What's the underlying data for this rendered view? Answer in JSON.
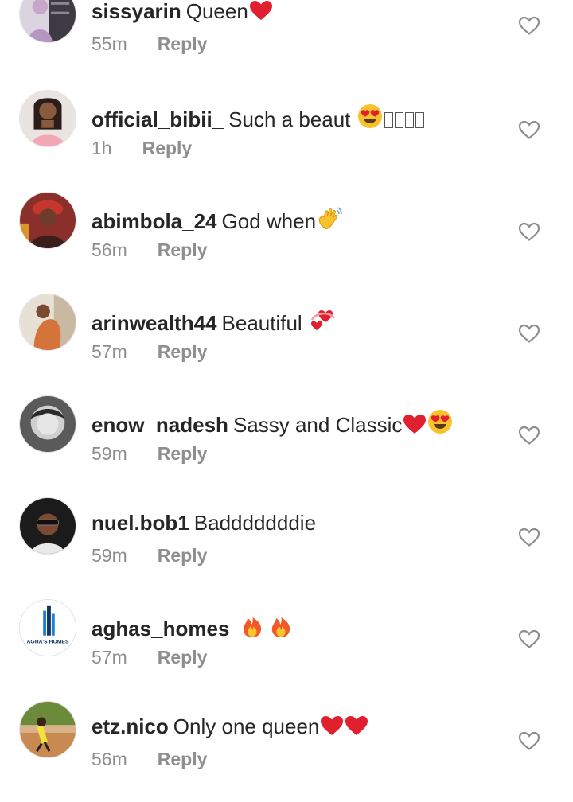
{
  "comments": [
    {
      "username": "sissyarin",
      "text": "Queen",
      "time": "55m",
      "reply": "Reply",
      "emojis": [
        "red-heart"
      ]
    },
    {
      "username": "official_bibii_",
      "text": "Such a beaut",
      "time": "1h",
      "reply": "Reply",
      "emojis": [
        "heart-eyes",
        "missing-glyph",
        "missing-glyph",
        "missing-glyph",
        "missing-glyph"
      ]
    },
    {
      "username": "abimbola_24",
      "text": "God when",
      "time": "56m",
      "reply": "Reply",
      "emojis": [
        "waving-hand"
      ]
    },
    {
      "username": "arinwealth44",
      "text": "Beautiful",
      "time": "57m",
      "reply": "Reply",
      "emojis": [
        "revolving-hearts"
      ]
    },
    {
      "username": "enow_nadesh",
      "text": "Sassy and Classic",
      "time": "59m",
      "reply": "Reply",
      "emojis": [
        "red-heart",
        "heart-eyes"
      ]
    },
    {
      "username": "nuel.bob1",
      "text": "Badddddddie",
      "time": "59m",
      "reply": "Reply",
      "emojis": []
    },
    {
      "username": "aghas_homes",
      "text": "",
      "time": "57m",
      "reply": "Reply",
      "emojis": [
        "fire",
        "fire"
      ]
    },
    {
      "username": "etz.nico",
      "text": "Only one queen",
      "time": "56m",
      "reply": "Reply",
      "emojis": [
        "red-heart",
        "red-heart"
      ]
    }
  ],
  "avatar_logo_text": "AGHA'S HOMES",
  "colors": {
    "text": "#262626",
    "muted": "#8e8e8e",
    "heart_outline": "#8e8e8e",
    "emoji_red": "#e0202e"
  }
}
